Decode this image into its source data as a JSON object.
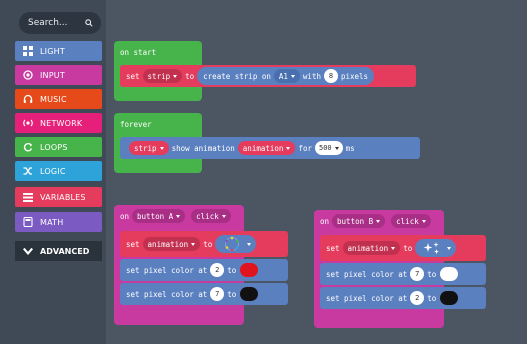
{
  "sidebar": {
    "search_label": "Search...",
    "categories": [
      {
        "label": "LIGHT",
        "icon": "grid-icon",
        "color": "#5b80c0"
      },
      {
        "label": "INPUT",
        "icon": "target-icon",
        "color": "#c83aa0"
      },
      {
        "label": "MUSIC",
        "icon": "headphones-icon",
        "color": "#e64a1a"
      },
      {
        "label": "NETWORK",
        "icon": "broadcast-icon",
        "color": "#e6207a"
      },
      {
        "label": "LOOPS",
        "icon": "loop-icon",
        "color": "#47b34b"
      },
      {
        "label": "LOGIC",
        "icon": "shuffle-icon",
        "color": "#2ea3d9"
      },
      {
        "label": "VARIABLES",
        "icon": "lines-icon",
        "color": "#e53b5c"
      },
      {
        "label": "MATH",
        "icon": "calculator-icon",
        "color": "#7b5ac1"
      }
    ],
    "advanced_label": "ADVANCED"
  },
  "workspace": {
    "on_start": {
      "label": "on start",
      "set": "set",
      "var": "strip",
      "to": "to",
      "create": "create strip on",
      "pin": "A1",
      "with": "with",
      "count": "8",
      "pixels": "pixels"
    },
    "forever": {
      "label": "forever",
      "strip": "strip",
      "show": "show animation",
      "animation": "animation",
      "for": "for",
      "ms_value": "500",
      "ms": "ms"
    },
    "button_a": {
      "on": "on",
      "button": "button A",
      "event": "click",
      "set": "set",
      "var": "animation",
      "to": "to",
      "pixel1_label": "set pixel color at",
      "pixel1_index": "2",
      "pixel1_to": "to",
      "pixel1_color": "#e0141e",
      "pixel2_label": "set pixel color at",
      "pixel2_index": "7",
      "pixel2_to": "to",
      "pixel2_color": "#111111"
    },
    "button_b": {
      "on": "on",
      "button": "button B",
      "event": "click",
      "set": "set",
      "var": "animation",
      "to": "to",
      "pixel1_label": "set pixel color at",
      "pixel1_index": "7",
      "pixel1_to": "to",
      "pixel1_color": "#ffffff",
      "pixel2_label": "set pixel color at",
      "pixel2_index": "2",
      "pixel2_to": "to",
      "pixel2_color": "#111111"
    }
  },
  "colors": {
    "input": "#c83aa0",
    "light": "#5b80c0",
    "loops": "#47b34b",
    "variables": "#e53b5c"
  }
}
